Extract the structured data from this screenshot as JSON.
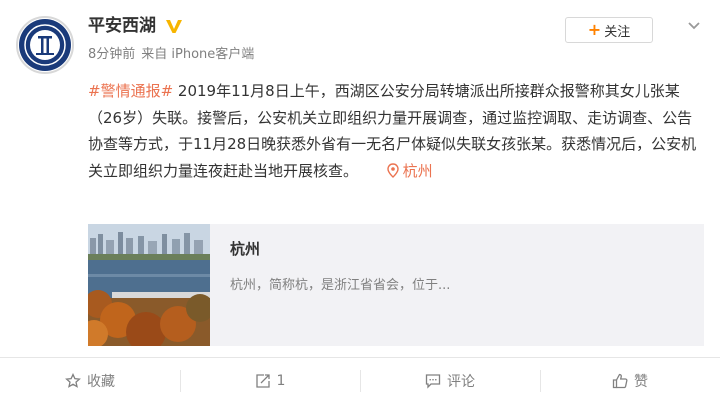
{
  "user": {
    "name": "平安西湖",
    "time": "8分钟前",
    "source": "来自 iPhone客户端"
  },
  "follow": {
    "label": "关注"
  },
  "post": {
    "hashtag": "#警情通报#",
    "text": " 2019年11月8日上午，西湖区公安分局转塘派出所接群众报警称其女儿张某（26岁）失联。接警后，公安机关立即组织力量开展调查，通过监控调取、走访调查、公告协查等方式，于11月28日晚获悉外省有一无名尸体疑似失联女孩张某。获悉情况后，公安机关立即组织力量连夜赶赴当地开展核查。",
    "location": "杭州"
  },
  "card": {
    "title": "杭州",
    "description": "杭州，简称杭，是浙江省省会，位于..."
  },
  "actions": {
    "favorite": "收藏",
    "repost": "1",
    "comment": "评论",
    "like": "赞"
  },
  "colors": {
    "accent": "#eb7350",
    "follow_plus": "#ff8200",
    "verified": "#f7b500",
    "card_bg": "#f2f2f5"
  }
}
